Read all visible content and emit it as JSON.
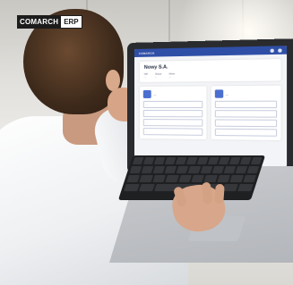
{
  "logo": {
    "left": "COMARCH",
    "right": "ERP"
  },
  "app": {
    "topbar_brand": "COMARCH",
    "company_title": "Nowy S.A.",
    "meta": [
      {
        "k": "NIP",
        "v": "..."
      },
      {
        "k": "Status",
        "v": "..."
      },
      {
        "k": "Adres",
        "v": "..."
      }
    ],
    "cards": [
      {
        "title": "...",
        "fields": [
          {
            "label": "...",
            "value": ""
          },
          {
            "label": "...",
            "value": ""
          },
          {
            "label": "...",
            "value": ""
          },
          {
            "label": "...",
            "value": ""
          }
        ]
      },
      {
        "title": "...",
        "fields": [
          {
            "label": "...",
            "value": ""
          },
          {
            "label": "...",
            "value": ""
          },
          {
            "label": "...",
            "value": ""
          },
          {
            "label": "...",
            "value": ""
          }
        ]
      }
    ]
  },
  "colors": {
    "accent": "#2f4fa7",
    "logo_dark": "#1c1c1c"
  }
}
